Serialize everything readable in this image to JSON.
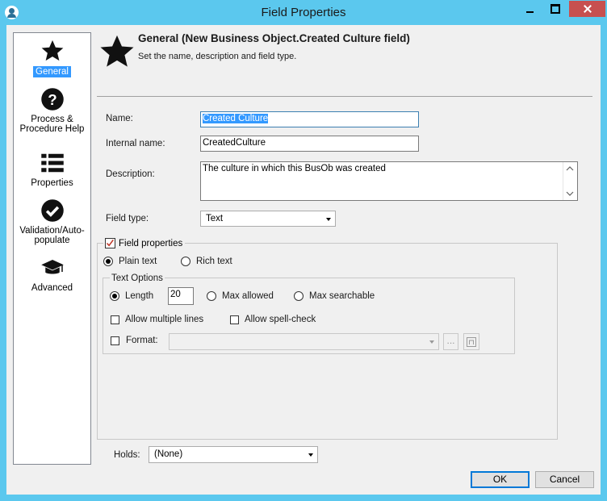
{
  "window": {
    "title": "Field Properties"
  },
  "sidebar": {
    "items": [
      {
        "label": "General",
        "icon": "star-icon",
        "active": true
      },
      {
        "label": "Process & Procedure Help",
        "label_line1": "Process &",
        "label_line2": "Procedure Help",
        "icon": "question-circle-icon"
      },
      {
        "label": "Properties",
        "icon": "list-icon"
      },
      {
        "label": "Validation/Auto-populate",
        "label_line1": "Validation/Auto-",
        "label_line2": "populate",
        "icon": "check-circle-icon"
      },
      {
        "label": "Advanced",
        "icon": "graduation-cap-icon"
      }
    ]
  },
  "header": {
    "title": "General (New Business Object.Created Culture field)",
    "subtitle": "Set the name, description and field type."
  },
  "form": {
    "name_label": "Name:",
    "name_value": "Created Culture",
    "internal_name_label": "Internal name:",
    "internal_name_value": "CreatedCulture",
    "description_label": "Description:",
    "description_value": "The culture in which this BusOb was created",
    "field_type_label": "Field type:",
    "field_type_value": "Text"
  },
  "field_properties": {
    "label": "Field properties",
    "checked": true,
    "plain_text_label": "Plain text",
    "rich_text_label": "Rich text",
    "text_options": {
      "label": "Text Options",
      "length_label": "Length",
      "length_value": "20",
      "max_allowed_label": "Max allowed",
      "max_searchable_label": "Max searchable",
      "allow_multiple_lines_label": "Allow multiple lines",
      "allow_spell_check_label": "Allow spell-check",
      "format_label": "Format:",
      "format_value": "",
      "ellipsis_label": "..."
    }
  },
  "holds": {
    "label": "Holds:",
    "value": "(None)"
  },
  "buttons": {
    "ok": "OK",
    "cancel": "Cancel"
  },
  "colors": {
    "titlebar": "#5bc8ee",
    "close": "#c7504f",
    "selection": "#3399ff"
  }
}
